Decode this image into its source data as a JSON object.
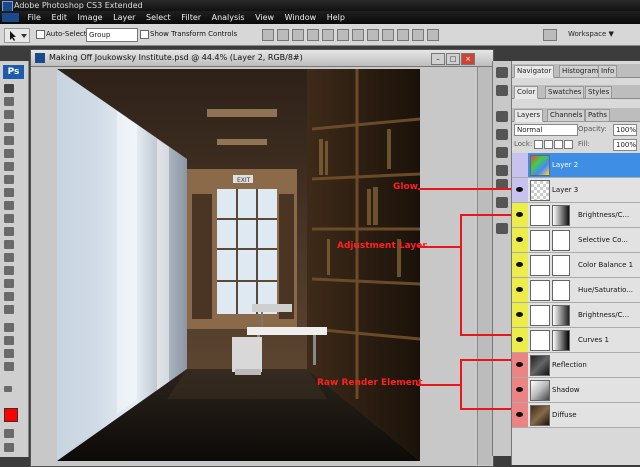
{
  "window": {
    "title": "Adobe Photoshop CS3 Extended"
  },
  "menu": [
    "File",
    "Edit",
    "Image",
    "Layer",
    "Select",
    "Filter",
    "Analysis",
    "View",
    "Window",
    "Help"
  ],
  "options": {
    "auto_select_label": "Auto-Select:",
    "auto_select_value": "Group",
    "show_transform_label": "Show Transform Controls",
    "workspace_label": "Workspace ▼"
  },
  "toolbox": {
    "logo": "Ps"
  },
  "document": {
    "title": "Making Off Joukowsky Institute.psd @ 44.4% (Layer 2, RGB/8#)"
  },
  "render": {
    "exit_sign": "EXIT"
  },
  "panels": {
    "top_tabs": [
      "Navigator",
      "Histogram",
      "Info"
    ],
    "mid_tabs": [
      "Color",
      "Swatches",
      "Styles"
    ],
    "layer_tabs": [
      "Layers",
      "Channels",
      "Paths"
    ],
    "blend_mode": "Normal",
    "opacity_label": "Opacity:",
    "opacity_value": "100%",
    "lock_label": "Lock:",
    "fill_label": "Fill:",
    "fill_value": "100%"
  },
  "layers": [
    {
      "name": "Layer 2",
      "group": "selected"
    },
    {
      "name": "Layer 3",
      "group": "glow"
    },
    {
      "name": "Brightness/C...",
      "group": "adjustment"
    },
    {
      "name": "Selective Co...",
      "group": "adjustment"
    },
    {
      "name": "Color Balance 1",
      "group": "adjustment"
    },
    {
      "name": "Hue/Saturatio...",
      "group": "adjustment"
    },
    {
      "name": "Brightness/C...",
      "group": "adjustment"
    },
    {
      "name": "Curves 1",
      "group": "adjustment"
    },
    {
      "name": "Reflection",
      "group": "raw"
    },
    {
      "name": "Shadow",
      "group": "raw"
    },
    {
      "name": "Diffuse",
      "group": "raw"
    }
  ],
  "annotations": {
    "glow": "Glow",
    "adjustment": "Adjustment Layer",
    "raw": "Raw Render Element"
  },
  "colors": {
    "annotation": "#ff2020",
    "selected_layer": "#3e8ee6",
    "glow_row": "#c8c2ef",
    "adjustment_row": "#ecec4a",
    "raw_row": "#ec8484",
    "foreground": "#ff0000"
  }
}
